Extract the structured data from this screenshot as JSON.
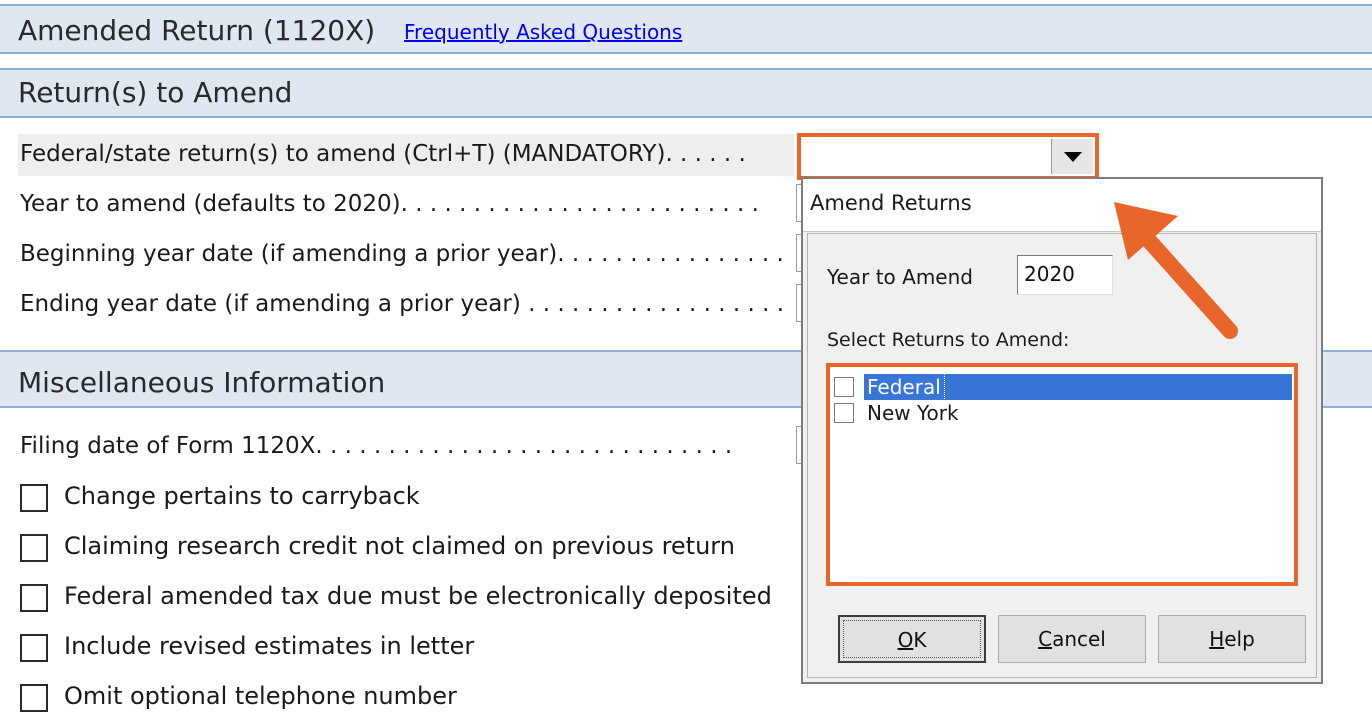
{
  "header": {
    "title": "Amended Return (1120X)",
    "faq_link": "Frequently Asked Questions"
  },
  "section_amend": {
    "title": "Return(s) to Amend",
    "fields": [
      {
        "label": "Federal/state return(s) to amend (Ctrl+T) (MANDATORY). . . . . ."
      },
      {
        "label": "Year to amend (defaults to 2020). . . . . . . . . . . . . . . . . . . . . . . . ."
      },
      {
        "label": "Beginning year date (if amending a prior year). . . . . . . . . . . . . . . ."
      },
      {
        "label": "Ending year date (if amending a prior year) . . . . . . . . . . . . . . . . . ."
      }
    ]
  },
  "section_misc": {
    "title": "Miscellaneous Information",
    "filing_date_label": "Filing date of Form 1120X. . . . . . . . . . . . . . . . . . . . . . . . . . . . .",
    "checkboxes": [
      {
        "label": "Change pertains to carryback",
        "checked": false
      },
      {
        "label": "Claiming research credit not claimed on previous return",
        "checked": false
      },
      {
        "label": "Federal amended tax due must be electronically deposited",
        "checked": false
      },
      {
        "label": "Include revised estimates in letter",
        "checked": false
      },
      {
        "label": "Omit optional telephone number",
        "checked": false
      }
    ]
  },
  "dialog": {
    "title": "Amend Returns",
    "year_label": "Year to Amend",
    "year_value": "2020",
    "select_label": "Select Returns to Amend:",
    "returns": [
      {
        "label": "Federal",
        "checked": false,
        "selected": true
      },
      {
        "label": "New York",
        "checked": false,
        "selected": false
      }
    ],
    "buttons": {
      "ok": {
        "mnemonic": "O",
        "rest": "K"
      },
      "cancel": {
        "mnemonic": "C",
        "rest": "ancel"
      },
      "help": {
        "mnemonic": "H",
        "rest": "elp"
      }
    }
  },
  "colors": {
    "highlight_orange": "#e9662b",
    "section_bg": "#dfe7f1",
    "selection_blue": "#3875d7"
  }
}
